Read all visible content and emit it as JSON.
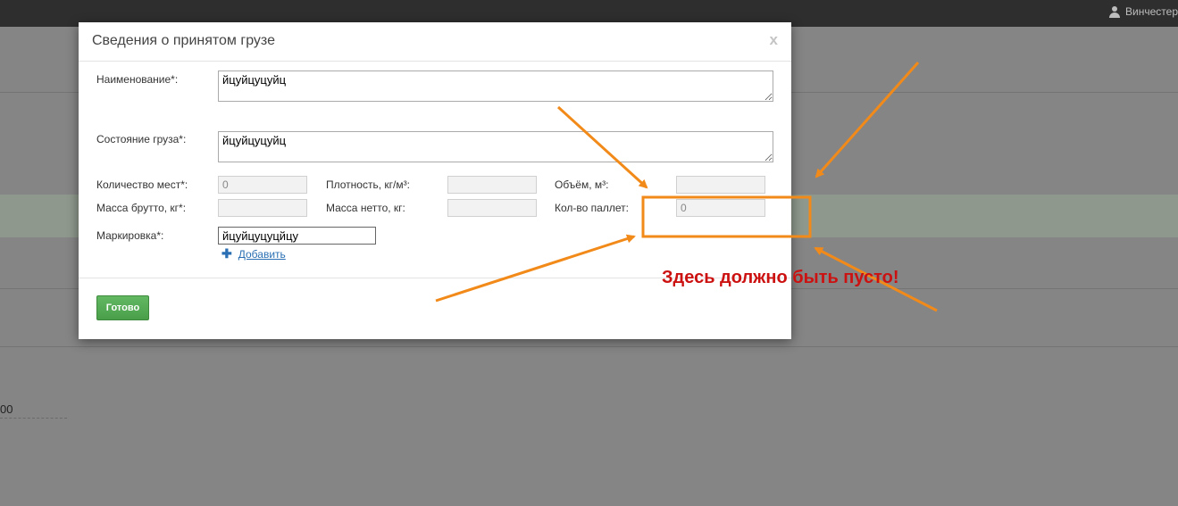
{
  "topbar": {
    "user_name": "Винчестер"
  },
  "background": {
    "partial_value": "00"
  },
  "modal": {
    "title": "Сведения о принятом грузе",
    "close_label": "x",
    "fields": {
      "name": {
        "label": "Наименование*:",
        "value": "йцуйцуцуйц"
      },
      "condition": {
        "label": "Состояние груза*:",
        "value": "йцуйцуцуйц"
      },
      "places": {
        "label": "Количество мест*:",
        "value": "0"
      },
      "density": {
        "label": "Плотность, кг/м³:",
        "value": ""
      },
      "volume": {
        "label": "Объём, м³:",
        "value": ""
      },
      "gross": {
        "label": "Масса брутто, кг*:",
        "value": ""
      },
      "net": {
        "label": "Масса нетто, кг:",
        "value": ""
      },
      "pallets": {
        "label": "Кол-во паллет:",
        "value": "0"
      },
      "marking": {
        "label": "Маркировка*:",
        "value": "йцуйцуцуцйцу"
      }
    },
    "add_link_label": "Добавить",
    "done_button_label": "Готово"
  },
  "annotation": {
    "text": "Здесь должно быть пусто!",
    "arrow_color": "#f28a1a",
    "text_color": "#cc1111"
  }
}
